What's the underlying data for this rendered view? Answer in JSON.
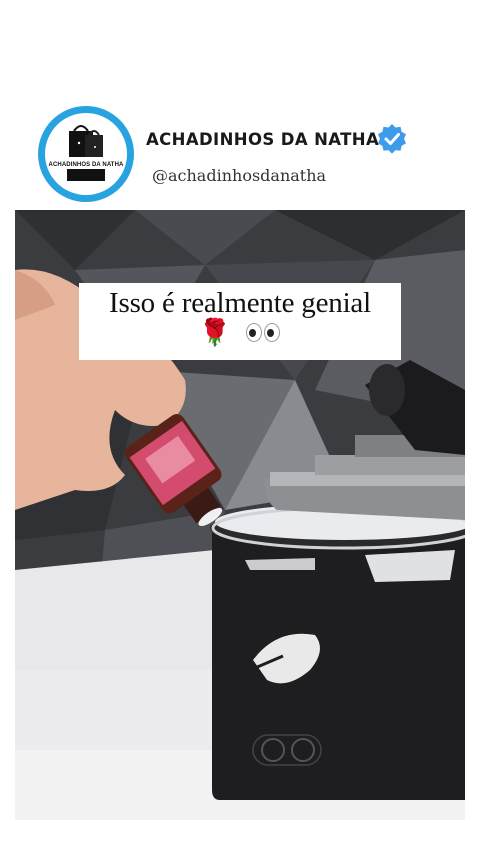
{
  "profile": {
    "name": "ACHADINHOS DA NATHA",
    "handle": "@achadinhosdanatha",
    "avatar_text": "ACHADINHOS DA NATHA",
    "verified_icon": "verified-badge-icon",
    "accent_color": "#29a3e0",
    "verified_color": "#3d9be9"
  },
  "video": {
    "caption": "Isso é realmente genial",
    "caption_emoji": "🌹"
  }
}
